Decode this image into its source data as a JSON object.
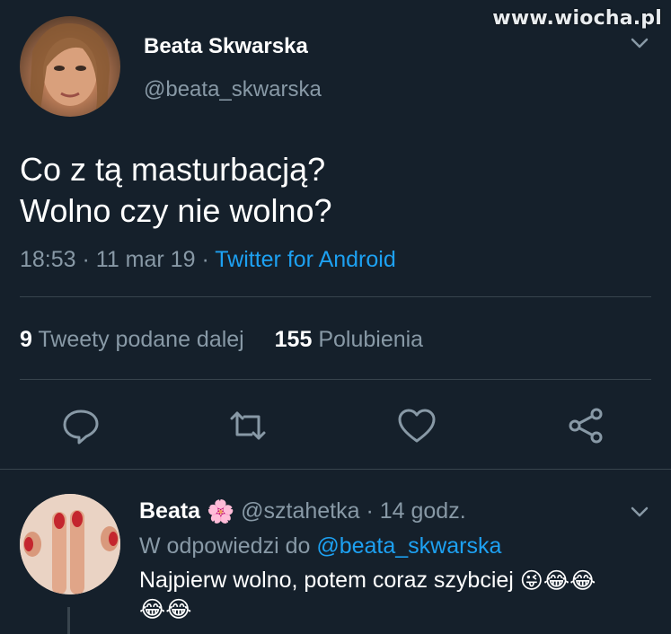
{
  "watermark": "www.wiocha.pl",
  "tweet": {
    "author_name": "Beata Skwarska",
    "author_handle": "@beata_skwarska",
    "text_line1": "Co z tą masturbacją?",
    "text_line2": "Wolno czy nie wolno?",
    "time": "18:53",
    "sep1": " · ",
    "date": "11 mar 19",
    "sep2": " · ",
    "source": "Twitter for Android",
    "retweets_count": "9",
    "retweets_label": "Tweety podane dalej",
    "likes_count": "155",
    "likes_label": "Polubienia"
  },
  "actions": {
    "reply_icon": "reply-icon",
    "retweet_icon": "retweet-icon",
    "like_icon": "heart-icon",
    "share_icon": "share-icon"
  },
  "reply": {
    "author_name": "Beata",
    "flower_emoji": "🌸",
    "author_handle": "@sztahetka",
    "sep": " · ",
    "time_ago": "14 godz.",
    "replying_to_label": "W odpowiedzi do ",
    "replying_to_handle": "@beata_skwarska",
    "text": "Najpierw wolno,  potem coraz szybciej",
    "emojis": [
      "😜",
      "😂",
      "😂",
      "😂",
      "😂"
    ]
  },
  "colors": {
    "background": "#15202b",
    "secondary_text": "#8899a6",
    "accent": "#1da1f2",
    "divider": "#38444d"
  }
}
